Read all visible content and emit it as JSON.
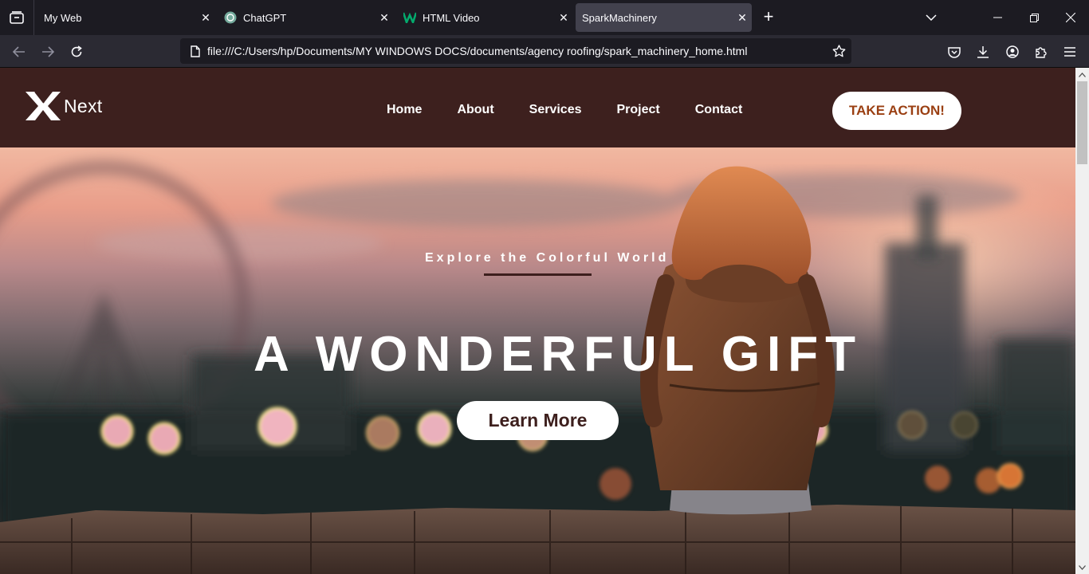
{
  "browser": {
    "tabs": [
      {
        "title": "My Web",
        "active": false,
        "icon": "none"
      },
      {
        "title": "ChatGPT",
        "active": false,
        "icon": "chatgpt-icon"
      },
      {
        "title": "HTML Video",
        "active": false,
        "icon": "w-logo-icon"
      },
      {
        "title": "SparkMachinery",
        "active": true,
        "icon": "none"
      }
    ],
    "url": "file:///C:/Users/hp/Documents/MY WINDOWS DOCS/documents/agency roofing/spark_machinery_home.html"
  },
  "site": {
    "logo_text": "Next",
    "menu": [
      "Home",
      "About",
      "Services",
      "Project",
      "Contact"
    ],
    "cta_label": "TAKE ACTION!",
    "hero": {
      "subtitle": "Explore the Colorful World",
      "title": "A WONDERFUL GIFT",
      "button_label": "Learn More"
    },
    "colors": {
      "header_bg": "#3d201e",
      "accent": "#9a3f12",
      "underline": "#3d1f1d"
    }
  }
}
